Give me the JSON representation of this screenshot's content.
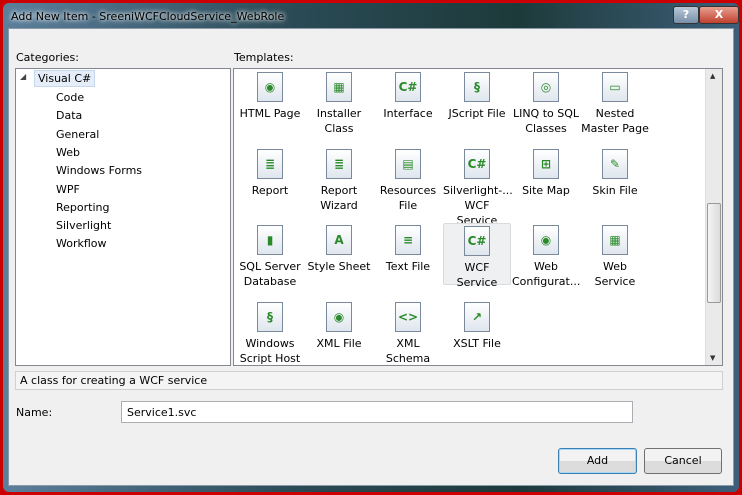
{
  "window": {
    "title": "Add New Item - SreeniWCFCloudService_WebRole",
    "help": "?",
    "close": "X"
  },
  "categories": {
    "label": "Categories:",
    "root": "Visual C#",
    "items": [
      "Code",
      "Data",
      "General",
      "Web",
      "Windows Forms",
      "WPF",
      "Reporting",
      "Silverlight",
      "Workflow"
    ]
  },
  "templates": {
    "label": "Templates:",
    "items": [
      {
        "label": "HTML Page",
        "icon": "html-page-icon",
        "glyph": "◉"
      },
      {
        "label": "Installer Class",
        "icon": "installer-class-icon",
        "glyph": "▦"
      },
      {
        "label": "Interface",
        "icon": "interface-icon",
        "glyph": "C#"
      },
      {
        "label": "JScript File",
        "icon": "jscript-file-icon",
        "glyph": "§"
      },
      {
        "label": "LINQ to SQL Classes",
        "icon": "linq-to-sql-icon",
        "glyph": "◎"
      },
      {
        "label": "Nested Master Page",
        "icon": "nested-master-page-icon",
        "glyph": "▭"
      },
      {
        "label": "Report",
        "icon": "report-icon",
        "glyph": "≣"
      },
      {
        "label": "Report Wizard",
        "icon": "report-wizard-icon",
        "glyph": "≣"
      },
      {
        "label": "Resources File",
        "icon": "resources-file-icon",
        "glyph": "▤"
      },
      {
        "label": "Silverlight-... WCF Service",
        "icon": "silverlight-wcf-icon",
        "glyph": "C#"
      },
      {
        "label": "Site Map",
        "icon": "site-map-icon",
        "glyph": "⊞"
      },
      {
        "label": "Skin File",
        "icon": "skin-file-icon",
        "glyph": "✎"
      },
      {
        "label": "SQL Server Database",
        "icon": "database-icon",
        "glyph": "▮"
      },
      {
        "label": "Style Sheet",
        "icon": "style-sheet-icon",
        "glyph": "A"
      },
      {
        "label": "Text File",
        "icon": "text-file-icon",
        "glyph": "≡"
      },
      {
        "label": "WCF Service",
        "icon": "wcf-service-icon",
        "glyph": "C#"
      },
      {
        "label": "Web Configurat...",
        "icon": "web-config-icon",
        "glyph": "◉"
      },
      {
        "label": "Web Service",
        "icon": "web-service-icon",
        "glyph": "▦"
      },
      {
        "label": "Windows Script Host",
        "icon": "script-host-icon",
        "glyph": "§"
      },
      {
        "label": "XML File",
        "icon": "xml-file-icon",
        "glyph": "◉"
      },
      {
        "label": "XML Schema",
        "icon": "xml-schema-icon",
        "glyph": "<>"
      },
      {
        "label": "XSLT File",
        "icon": "xslt-file-icon",
        "glyph": "↗"
      }
    ],
    "selected": "WCF Service"
  },
  "description": "A class for creating a WCF service",
  "name": {
    "label": "Name:",
    "value": "Service1.svc"
  },
  "buttons": {
    "add": "Add",
    "cancel": "Cancel"
  }
}
